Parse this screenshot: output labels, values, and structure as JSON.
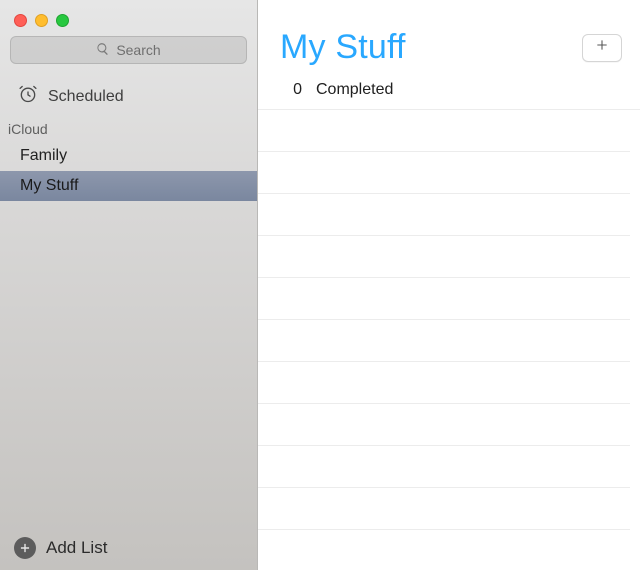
{
  "search": {
    "placeholder": "Search"
  },
  "scheduled": {
    "label": "Scheduled"
  },
  "section": {
    "label": "iCloud"
  },
  "lists": [
    {
      "name": "Family",
      "selected": false
    },
    {
      "name": "My Stuff",
      "selected": true
    }
  ],
  "footer": {
    "add_list_label": "Add List"
  },
  "main": {
    "title": "My Stuff",
    "completed_count": "0",
    "completed_label": "Completed"
  },
  "colors": {
    "accent": "#29a8ff"
  }
}
